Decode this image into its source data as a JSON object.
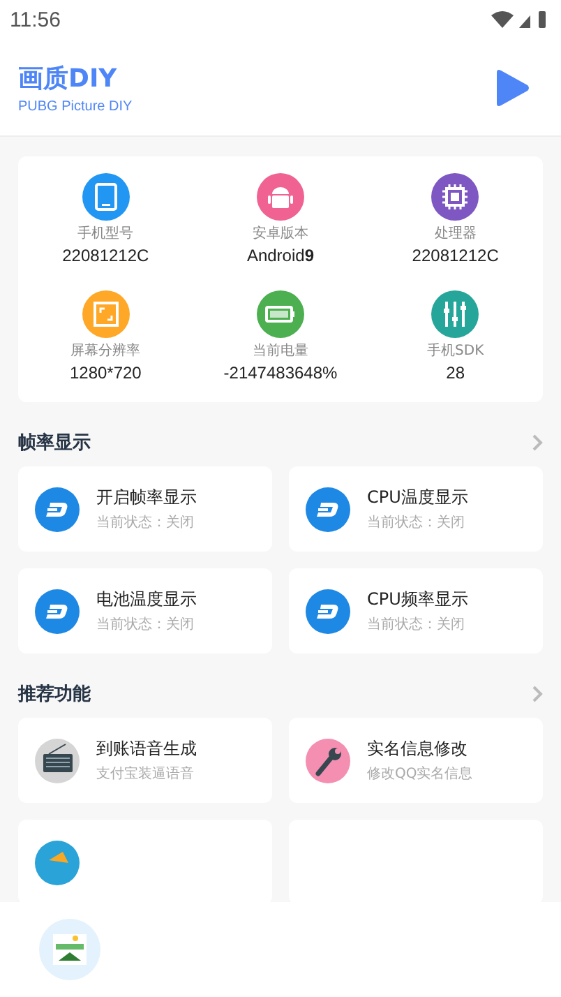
{
  "status_bar": {
    "time": "11:56"
  },
  "header": {
    "title": "画质DIY",
    "subtitle": "PUBG Picture DIY"
  },
  "device_info": [
    {
      "label": "手机型号",
      "value": "22081212C",
      "color": "#2196f3"
    },
    {
      "label": "安卓版本",
      "value": "Android**9**",
      "color": "#f06292"
    },
    {
      "label": "处理器",
      "value": "22081212C",
      "color": "#7e57c2"
    },
    {
      "label": "屏幕分辨率",
      "value": "1280*720",
      "color": "#ffa726"
    },
    {
      "label": "当前电量",
      "value": "-2147483648%",
      "color": "#4caf50"
    },
    {
      "label": "手机SDK",
      "value": "28",
      "color": "#26a69a"
    }
  ],
  "sections": [
    {
      "title": "帧率显示",
      "items": [
        {
          "title": "开启帧率显示",
          "subtitle": "当前状态：关闭"
        },
        {
          "title": "CPU温度显示",
          "subtitle": "当前状态：关闭"
        },
        {
          "title": "电池温度显示",
          "subtitle": "当前状态：关闭"
        },
        {
          "title": "CPU频率显示",
          "subtitle": "当前状态：关闭"
        }
      ]
    },
    {
      "title": "推荐功能",
      "items": [
        {
          "title": "到账语音生成",
          "subtitle": "支付宝装逼语音"
        },
        {
          "title": "实名信息修改",
          "subtitle": "修改QQ实名信息"
        }
      ]
    }
  ]
}
